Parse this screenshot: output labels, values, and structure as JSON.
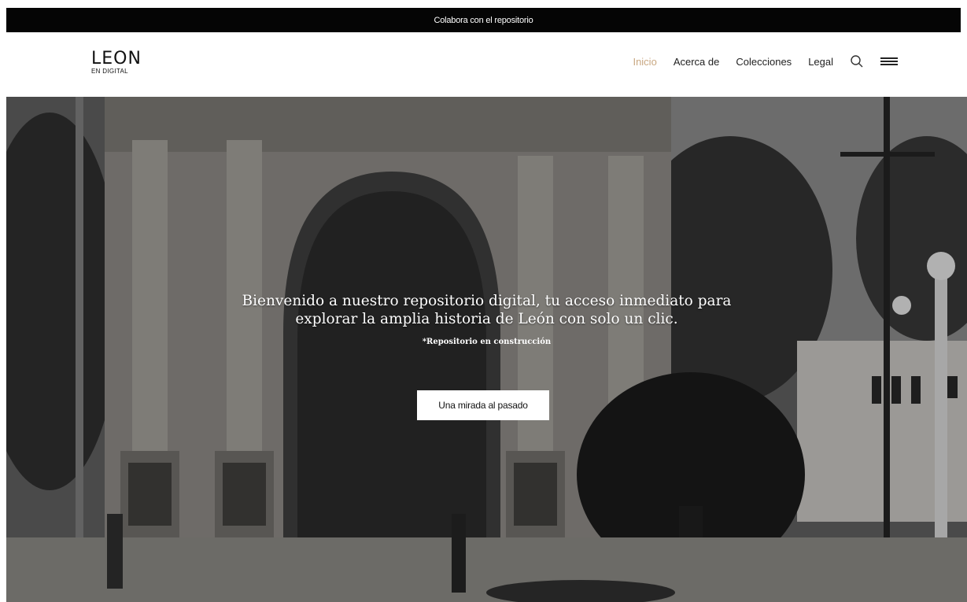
{
  "topbar": {
    "text": "Colabora con el repositorio"
  },
  "logo": {
    "main": "LEON",
    "sub": "EN DIGITAL"
  },
  "nav": {
    "items": [
      {
        "label": "Inicio",
        "active": true
      },
      {
        "label": "Acerca de",
        "active": false
      },
      {
        "label": "Colecciones",
        "active": false
      },
      {
        "label": "Legal",
        "active": false
      }
    ],
    "search_icon": "search-icon",
    "menu_icon": "hamburger-menu-icon",
    "accent_color": "#c9a882"
  },
  "hero": {
    "title": "Bienvenido a nuestro repositorio digital, tu acceso inmediato para explorar la amplia historia de León con solo un clic.",
    "note": "*Repositorio en construcción",
    "button_label": "Una mirada al pasado"
  }
}
